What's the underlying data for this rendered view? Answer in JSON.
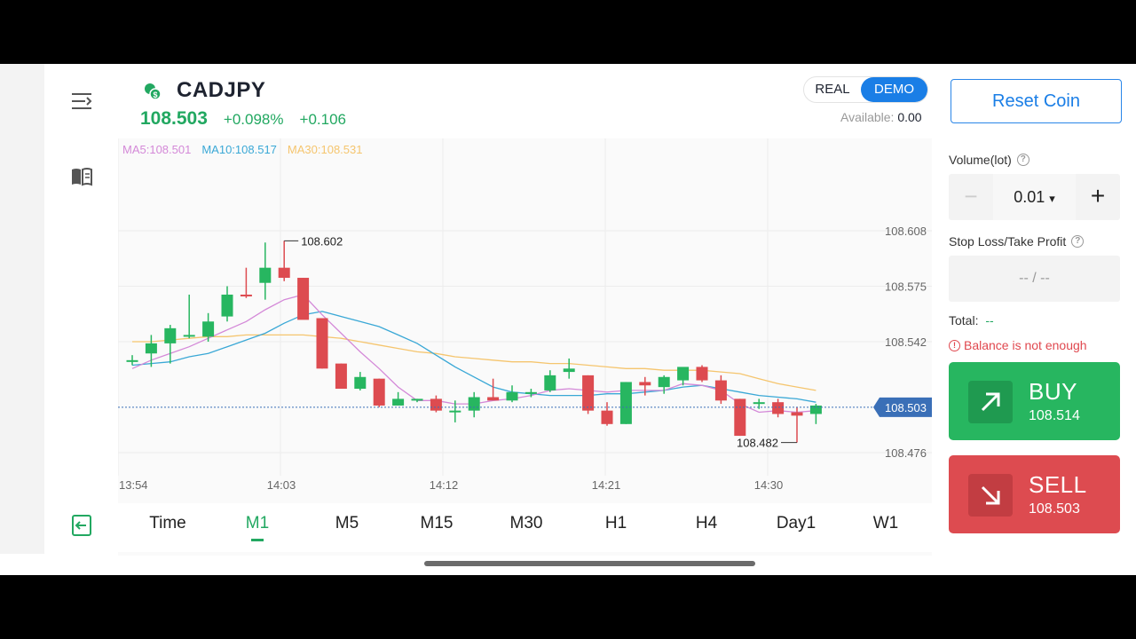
{
  "header": {
    "pair": "CADJPY",
    "price": "108.503",
    "change_pct": "+0.098%",
    "change_abs": "+0.106",
    "mode_real": "REAL",
    "mode_demo": "DEMO",
    "available_label": "Available:",
    "available_value": "0.00"
  },
  "legend": {
    "ma5": "MA5:108.501",
    "ma10": "MA10:108.517",
    "ma30": "MA30:108.531"
  },
  "timeframes": [
    "Time",
    "M1",
    "M5",
    "M15",
    "M30",
    "H1",
    "H4",
    "Day1",
    "W1"
  ],
  "active_timeframe": "M1",
  "panel": {
    "reset_coin": "Reset Coin",
    "volume_label": "Volume(lot)",
    "volume_value": "0.01",
    "volume_caret": "▾",
    "minus": "−",
    "plus": "+",
    "sltp_label": "Stop Loss/Take Profit",
    "sltp_value": "-- / --",
    "total_label": "Total:",
    "total_value": "--",
    "balance_warning": "Balance is not enough",
    "buy_label": "BUY",
    "buy_price": "108.514",
    "sell_label": "SELL",
    "sell_price": "108.503"
  },
  "colors": {
    "up": "#27b660",
    "down": "#dd4b50",
    "ma5": "#d489d8",
    "ma10": "#3aa8d6",
    "ma30": "#f5c56e",
    "accent": "#1a7ee6"
  },
  "chart_data": {
    "type": "candlestick",
    "y_ticks": [
      "108.608",
      "108.575",
      "108.542",
      "108.476"
    ],
    "x_ticks": [
      "13:54",
      "14:03",
      "14:12",
      "14:21",
      "14:30"
    ],
    "ylim": [
      108.463,
      108.616
    ],
    "last_price": "108.503",
    "high_label": "108.602",
    "low_label": "108.482",
    "candles": [
      {
        "o": 108.531,
        "h": 108.534,
        "l": 108.528,
        "c": 108.531
      },
      {
        "o": 108.535,
        "h": 108.546,
        "l": 108.527,
        "c": 108.541
      },
      {
        "o": 108.541,
        "h": 108.552,
        "l": 108.529,
        "c": 108.55
      },
      {
        "o": 108.546,
        "h": 108.57,
        "l": 108.544,
        "c": 108.546
      },
      {
        "o": 108.545,
        "h": 108.559,
        "l": 108.542,
        "c": 108.554
      },
      {
        "o": 108.557,
        "h": 108.575,
        "l": 108.554,
        "c": 108.57
      },
      {
        "o": 108.57,
        "h": 108.586,
        "l": 108.568,
        "c": 108.569
      },
      {
        "o": 108.577,
        "h": 108.601,
        "l": 108.567,
        "c": 108.586
      },
      {
        "o": 108.586,
        "h": 108.602,
        "l": 108.578,
        "c": 108.58
      },
      {
        "o": 108.58,
        "h": 108.58,
        "l": 108.56,
        "c": 108.555
      },
      {
        "o": 108.556,
        "h": 108.556,
        "l": 108.526,
        "c": 108.526
      },
      {
        "o": 108.529,
        "h": 108.529,
        "l": 108.516,
        "c": 108.514
      },
      {
        "o": 108.514,
        "h": 108.524,
        "l": 108.513,
        "c": 108.521
      },
      {
        "o": 108.52,
        "h": 108.52,
        "l": 108.503,
        "c": 108.504
      },
      {
        "o": 108.504,
        "h": 108.512,
        "l": 108.505,
        "c": 108.508
      },
      {
        "o": 108.508,
        "h": 108.508,
        "l": 108.506,
        "c": 108.508
      },
      {
        "o": 108.508,
        "h": 108.51,
        "l": 108.5,
        "c": 108.501
      },
      {
        "o": 108.501,
        "h": 108.507,
        "l": 108.494,
        "c": 108.501
      },
      {
        "o": 108.501,
        "h": 108.512,
        "l": 108.497,
        "c": 108.509
      },
      {
        "o": 108.509,
        "h": 108.52,
        "l": 108.508,
        "c": 108.507
      },
      {
        "o": 108.507,
        "h": 108.516,
        "l": 108.506,
        "c": 108.512
      },
      {
        "o": 108.512,
        "h": 108.514,
        "l": 108.509,
        "c": 108.512
      },
      {
        "o": 108.513,
        "h": 108.525,
        "l": 108.512,
        "c": 108.522
      },
      {
        "o": 108.524,
        "h": 108.532,
        "l": 108.52,
        "c": 108.526
      },
      {
        "o": 108.522,
        "h": 108.522,
        "l": 108.499,
        "c": 108.501
      },
      {
        "o": 108.501,
        "h": 108.506,
        "l": 108.492,
        "c": 108.493
      },
      {
        "o": 108.493,
        "h": 108.518,
        "l": 108.493,
        "c": 108.518
      },
      {
        "o": 108.518,
        "h": 108.521,
        "l": 108.51,
        "c": 108.516
      },
      {
        "o": 108.515,
        "h": 108.522,
        "l": 108.511,
        "c": 108.521
      },
      {
        "o": 108.519,
        "h": 108.526,
        "l": 108.516,
        "c": 108.527
      },
      {
        "o": 108.527,
        "h": 108.528,
        "l": 108.518,
        "c": 108.519
      },
      {
        "o": 108.519,
        "h": 108.522,
        "l": 108.505,
        "c": 108.507
      },
      {
        "o": 108.508,
        "h": 108.508,
        "l": 108.486,
        "c": 108.486
      },
      {
        "o": 108.506,
        "h": 108.508,
        "l": 108.502,
        "c": 108.506
      },
      {
        "o": 108.506,
        "h": 108.508,
        "l": 108.497,
        "c": 108.499
      },
      {
        "o": 108.5,
        "h": 108.503,
        "l": 108.482,
        "c": 108.498
      },
      {
        "o": 108.499,
        "h": 108.505,
        "l": 108.493,
        "c": 108.504
      }
    ],
    "ma5": [
      108.526,
      108.531,
      108.535,
      108.539,
      108.544,
      108.549,
      108.554,
      108.561,
      108.567,
      108.57,
      108.558,
      108.547,
      108.536,
      108.526,
      108.515,
      108.507,
      108.507,
      108.505,
      108.505,
      108.507,
      108.508,
      108.51,
      108.513,
      108.514,
      108.513,
      108.512,
      108.513,
      108.513,
      108.513,
      108.517,
      108.516,
      108.513,
      108.505,
      108.5,
      108.501,
      108.5,
      108.501
    ],
    "ma10": [
      108.528,
      108.529,
      108.53,
      108.533,
      108.535,
      108.539,
      108.543,
      108.547,
      108.553,
      108.558,
      108.56,
      108.557,
      108.554,
      108.551,
      108.546,
      108.541,
      108.534,
      108.527,
      108.521,
      108.515,
      108.512,
      108.511,
      108.51,
      108.51,
      108.51,
      108.511,
      108.511,
      108.512,
      108.513,
      108.515,
      108.516,
      108.514,
      108.512,
      108.51,
      108.509,
      108.508,
      108.506
    ],
    "ma30": [
      108.542,
      108.542,
      108.543,
      108.544,
      108.545,
      108.545,
      108.546,
      108.546,
      108.546,
      108.546,
      108.545,
      108.544,
      108.542,
      108.54,
      108.538,
      108.536,
      108.535,
      108.533,
      108.532,
      108.531,
      108.53,
      108.53,
      108.529,
      108.529,
      108.528,
      108.527,
      108.526,
      108.526,
      108.525,
      108.525,
      108.525,
      108.524,
      108.523,
      108.52,
      108.517,
      108.515,
      108.513
    ]
  }
}
